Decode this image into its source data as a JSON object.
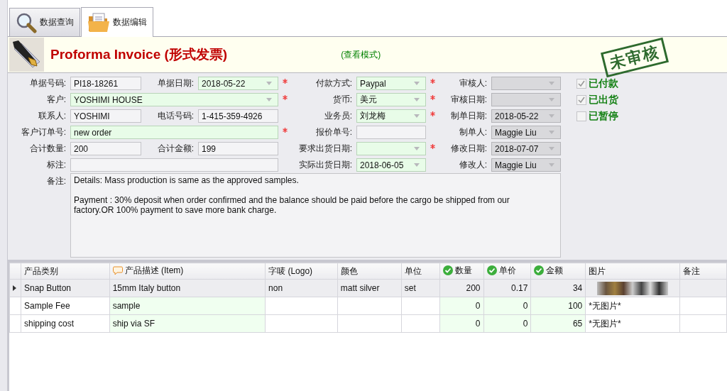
{
  "tabs": [
    {
      "label": "数据查询",
      "selected": false
    },
    {
      "label": "数据编辑",
      "selected": true
    }
  ],
  "header": {
    "title": "Proforma Invoice (形式发票)",
    "mode": "(查看模式)"
  },
  "stamp": "未审核",
  "form": {
    "left": [
      [
        {
          "label": "单据号码:",
          "value": "PI18-18261",
          "kind": "text",
          "readonly": true,
          "required": false
        },
        {
          "label": "单据日期:",
          "value": "2018-05-22",
          "kind": "dropdown",
          "readonly": false,
          "required": true
        }
      ],
      [
        {
          "label": "客户:",
          "value": "YOSHIMI HOUSE",
          "kind": "dropdown",
          "readonly": false,
          "required": true
        }
      ],
      [
        {
          "label": "联系人:",
          "value": "YOSHIMI",
          "kind": "text",
          "readonly": true,
          "required": false
        },
        {
          "label": "电话号码:",
          "value": "1-415-359-4926",
          "kind": "text",
          "readonly": true,
          "required": false
        }
      ],
      [
        {
          "label": "客户订单号:",
          "value": "new order",
          "kind": "text",
          "readonly": false,
          "required": true
        }
      ],
      [
        {
          "label": "合计数量:",
          "value": "200",
          "kind": "text",
          "readonly": true,
          "required": false
        },
        {
          "label": "合计金额:",
          "value": "199",
          "kind": "text",
          "readonly": true,
          "required": false
        }
      ],
      [
        {
          "label": "标注:",
          "kind": "text",
          "readonly": true,
          "required": false
        }
      ]
    ],
    "middle": [
      {
        "label": "付款方式:",
        "value": "Paypal",
        "kind": "dropdown",
        "readonly": false,
        "required": true
      },
      {
        "label": "货币:",
        "value": "美元",
        "kind": "dropdown",
        "readonly": false,
        "required": true
      },
      {
        "label": "业务员:",
        "value": "刘龙梅",
        "kind": "dropdown",
        "readonly": false,
        "required": true
      },
      {
        "label": "报价单号:",
        "kind": "text",
        "readonly": true,
        "required": false
      },
      {
        "label": "要求出货日期:",
        "kind": "dropdown",
        "readonly": false,
        "required": true
      },
      {
        "label": "实际出货日期:",
        "value": "2018-06-05",
        "kind": "dropdown",
        "readonly": false,
        "required": false
      }
    ],
    "right": [
      {
        "label": "审核人:",
        "kind": "dropdown",
        "disabled": true
      },
      {
        "label": "审核日期:",
        "kind": "dropdown",
        "disabled": true
      },
      {
        "label": "制单日期:",
        "value": "2018-05-22",
        "kind": "dropdown",
        "disabled": true
      },
      {
        "label": "制单人:",
        "value": "Maggie Liu",
        "kind": "dropdown",
        "disabled": true
      },
      {
        "label": "修改日期:",
        "value": "2018-07-07",
        "kind": "dropdown",
        "disabled": true
      },
      {
        "label": "修改人:",
        "value": "Maggie Liu",
        "kind": "dropdown",
        "disabled": true
      }
    ],
    "checkboxes": [
      {
        "label": "已付款",
        "checked": true
      },
      {
        "label": "已出货",
        "checked": true
      },
      {
        "label": "已暂停",
        "checked": false
      }
    ],
    "remarks": {
      "label": "备注:",
      "value": "Details: Mass production is same as the approved samples.\n\nPayment : 30% deposit when order confirmed and the balance should be paid before the cargo be shipped from our factory.OR 100% payment to save more bank charge."
    }
  },
  "table": {
    "columns": [
      {
        "label": "产品类别",
        "kind": "plain"
      },
      {
        "label": "产品描述 (Item)",
        "kind": "comment"
      },
      {
        "label": "字唛 (Logo)",
        "kind": "plain"
      },
      {
        "label": "颜色",
        "kind": "plain"
      },
      {
        "label": "单位",
        "kind": "plain"
      },
      {
        "label": "数量",
        "kind": "check"
      },
      {
        "label": "单价",
        "kind": "check"
      },
      {
        "label": "金额",
        "kind": "check"
      },
      {
        "label": "图片",
        "kind": "picture"
      },
      {
        "label": "备注",
        "kind": "plain"
      }
    ],
    "rows": [
      {
        "selected": true,
        "cells": [
          "Snap Button",
          "15mm Italy button",
          "non",
          "matt silver",
          "set",
          "200",
          "0.17",
          "34",
          {
            "photo": true
          },
          ""
        ]
      },
      {
        "selected": false,
        "cells": [
          "Sample Fee",
          "sample",
          "",
          "",
          "",
          "0",
          "0",
          "100",
          "*无图片*",
          ""
        ]
      },
      {
        "selected": false,
        "cells": [
          "shipping cost",
          "ship via SF",
          "",
          "",
          "",
          "0",
          "0",
          "65",
          "*无图片*",
          ""
        ]
      }
    ]
  }
}
